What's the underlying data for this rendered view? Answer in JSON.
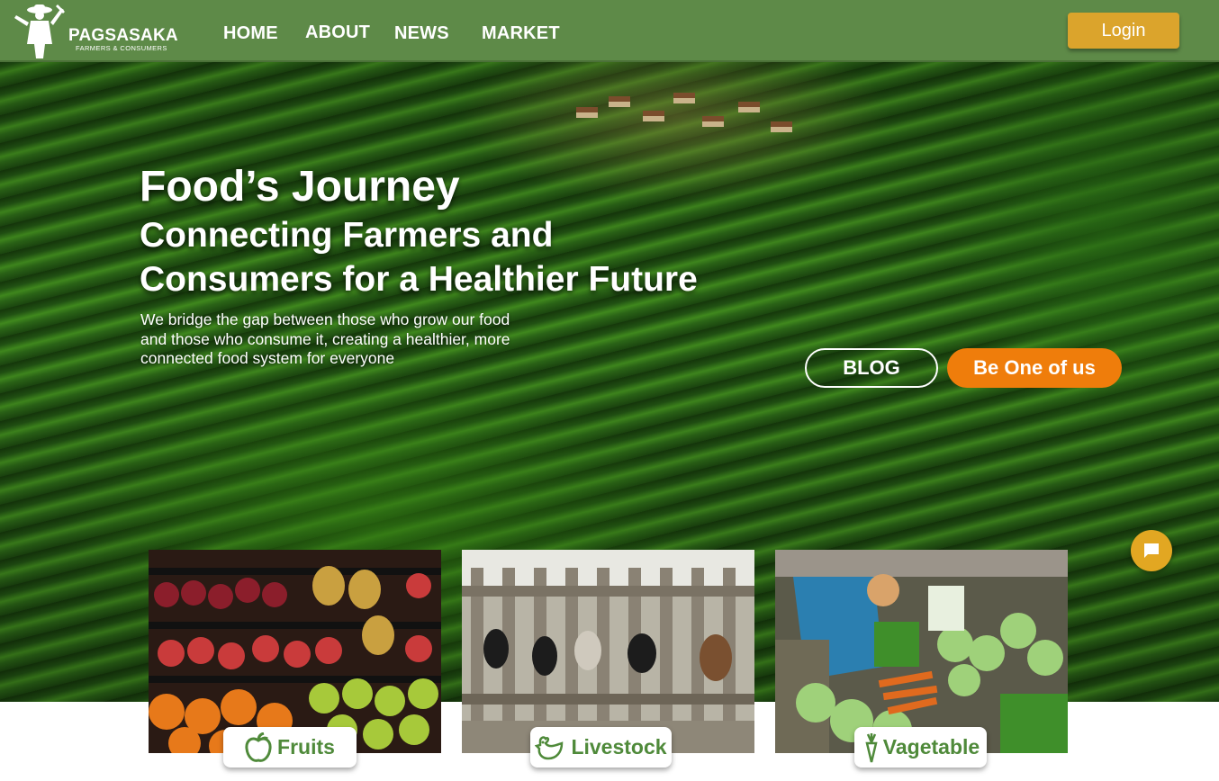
{
  "header": {
    "brand": "PAGSASAKA",
    "brand_sub": "FARMERS & CONSUMERS",
    "nav": [
      "HOME",
      "ABOUT",
      "NEWS",
      "MARKET"
    ],
    "login_label": "Login"
  },
  "hero": {
    "title": "Food’s Journey",
    "subtitle_line1": "Connecting Farmers and",
    "subtitle_line2": "Consumers for a Healthier Future",
    "description": "We bridge the gap between those who grow our food and those who consume it, creating a healthier, more connected food system for everyone",
    "blog_label": "BLOG",
    "join_label": "Be One of us"
  },
  "categories": [
    {
      "label": "Fruits",
      "icon": "apple-icon"
    },
    {
      "label": "Livestock",
      "icon": "chicken-icon"
    },
    {
      "label": "Vagetable",
      "icon": "carrot-icon"
    }
  ],
  "colors": {
    "navbar": "#5e8a48",
    "login": "#dba42c",
    "join": "#ef7d0b",
    "category_text": "#4f8a3a",
    "chat": "#e2a722"
  }
}
